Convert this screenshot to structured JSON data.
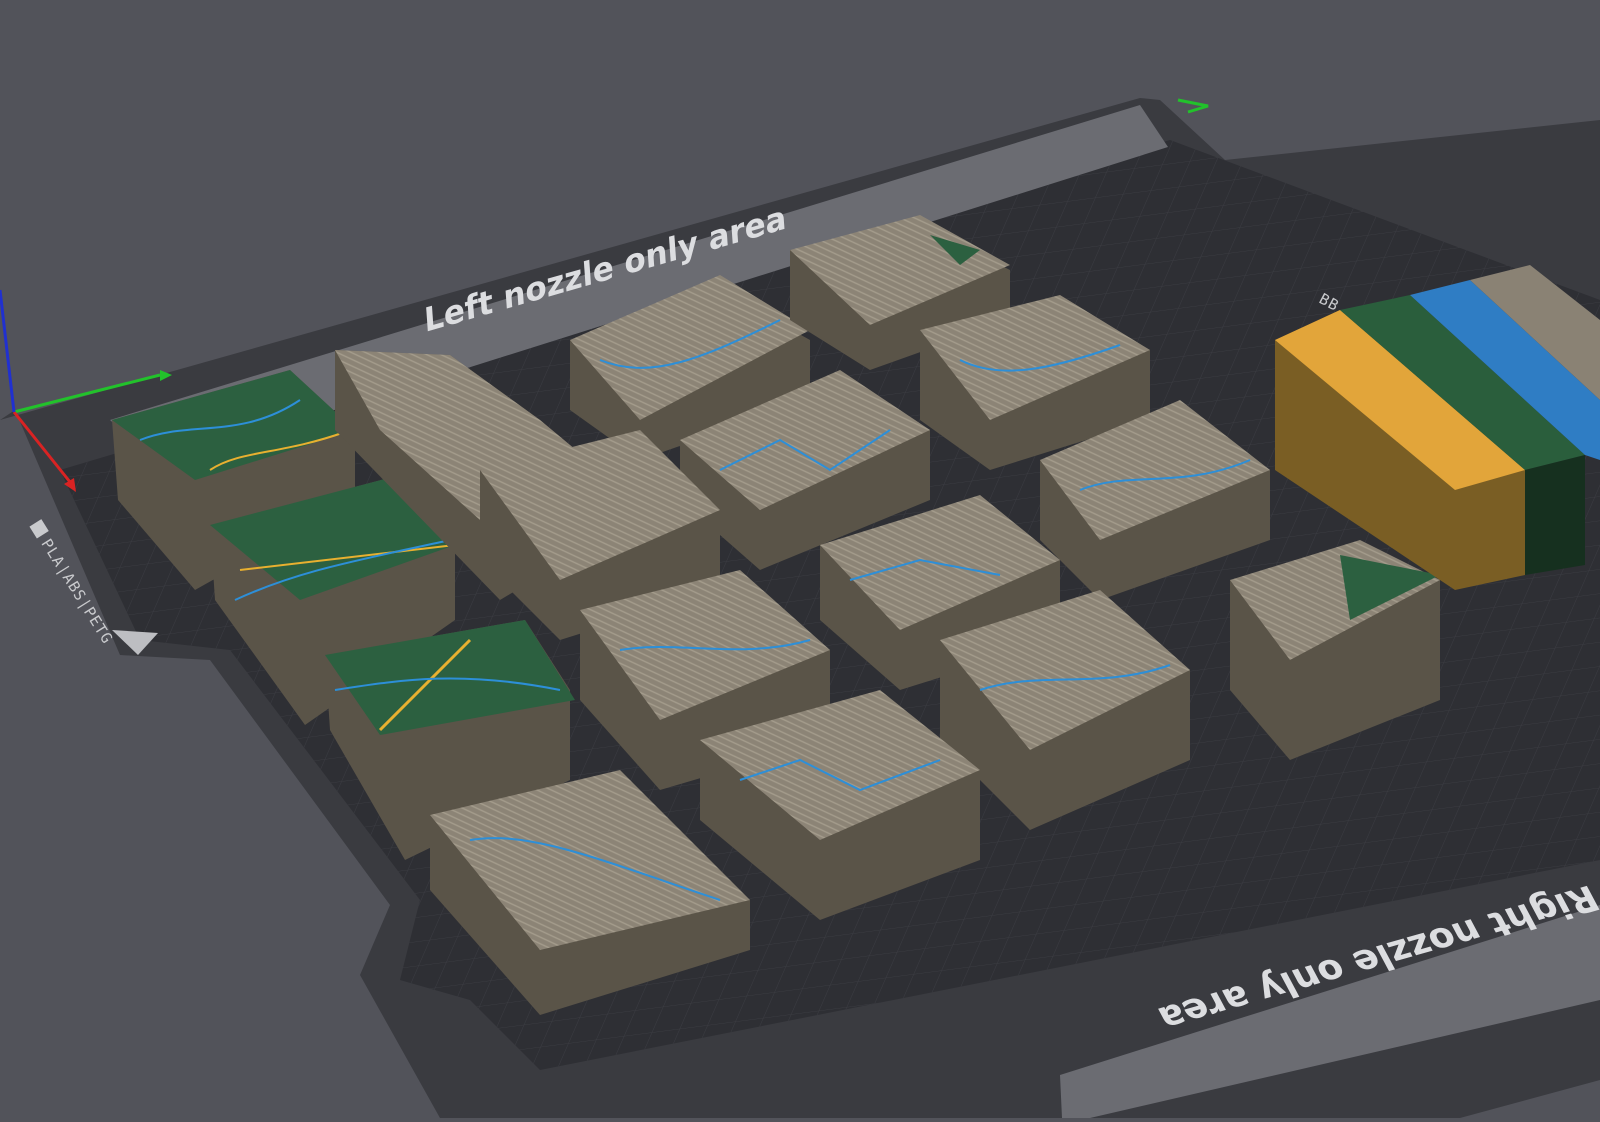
{
  "bed": {
    "left_zone_label": "Left nozzle only area",
    "right_zone_label": "Right nozzle only area",
    "filament_badge": "PLA|ABS|PETG",
    "prime_tower_badge": "BB"
  },
  "colors": {
    "background": "#52535a",
    "bed_frame": "#3a3b40",
    "bed_plate": "#2e2f34",
    "bed_strip": "#6b6c72",
    "terrain": "#8a8274",
    "terrain_side": "#5a5448",
    "forest": "#2c6040",
    "water": "#2d8fd8",
    "road": "#e8b030",
    "axis_x": "#d92323",
    "axis_y": "#22c22b",
    "axis_z": "#2030d0"
  },
  "prime_tower": {
    "stripe_colors": [
      "#e2a53a",
      "#2a5e3c",
      "#2f7dc4",
      "#8a8274"
    ]
  },
  "icons": [
    "axis-triad-icon",
    "bed-corner-marker-icon"
  ]
}
